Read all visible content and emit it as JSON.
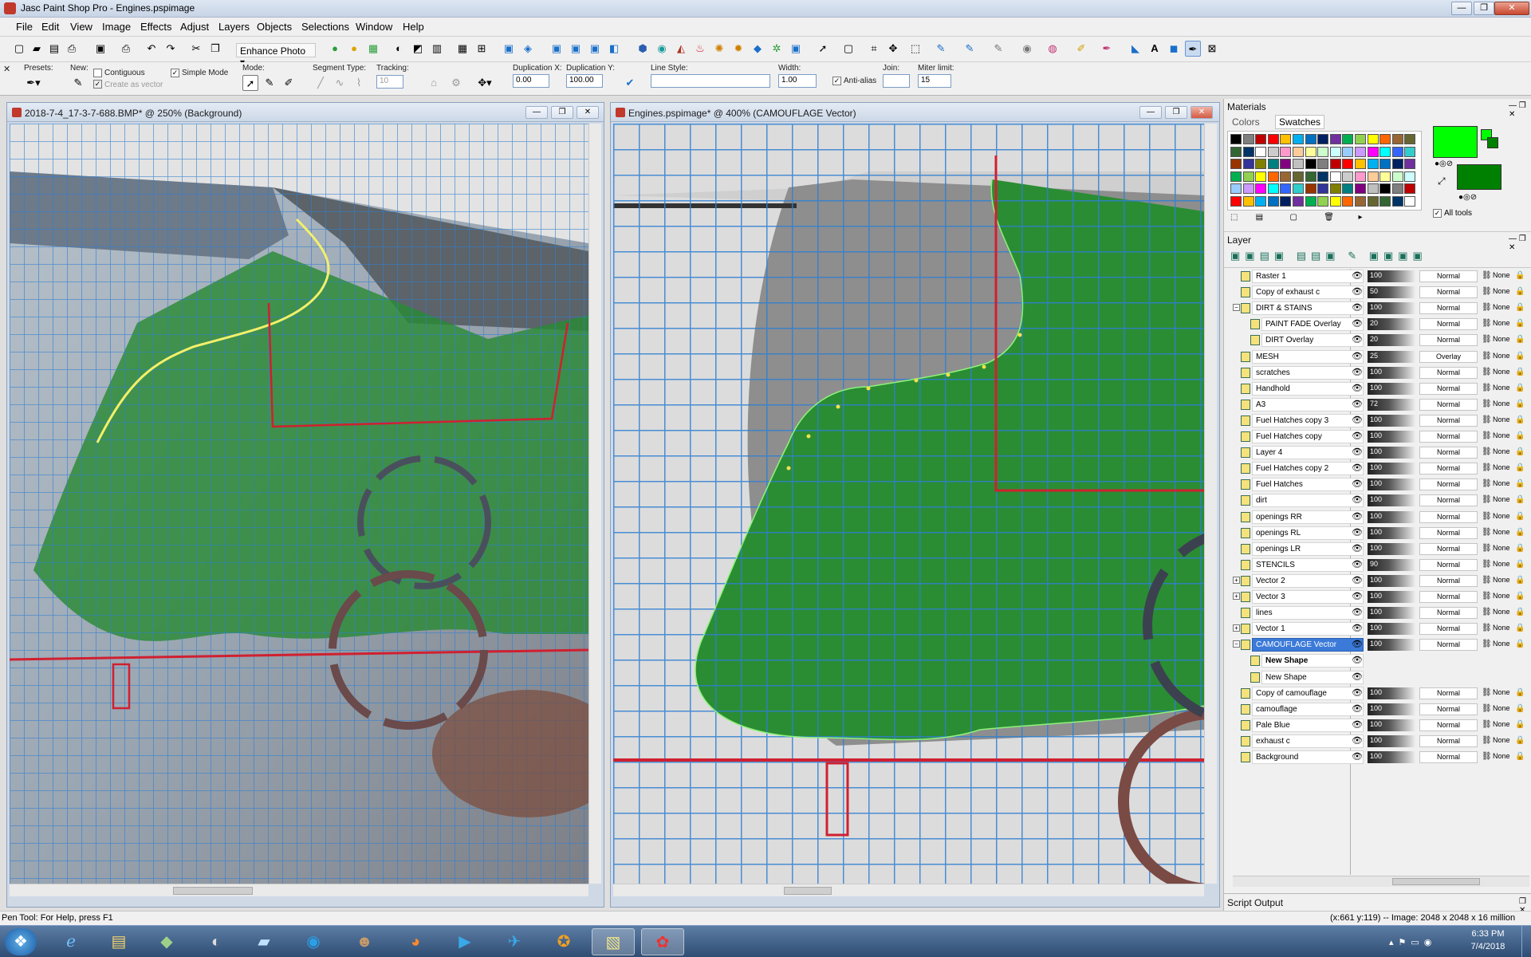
{
  "app": {
    "title": "Jasc Paint Shop Pro - Engines.pspimage",
    "window_buttons": [
      "—",
      "❐",
      "✕"
    ]
  },
  "menu": [
    "File",
    "Edit",
    "View",
    "Image",
    "Effects",
    "Adjust",
    "Layers",
    "Objects",
    "Selections",
    "Window",
    "Help"
  ],
  "toolbar": {
    "enhance_photo": "Enhance Photo ▾",
    "icons": [
      "new-icon",
      "open-icon",
      "browse-icon",
      "save-icon",
      "print-icon",
      "undo-icon",
      "redo-icon",
      "cut-icon",
      "copy-icon"
    ]
  },
  "tool_options": {
    "presets_label": "Presets:",
    "new_label": "New:",
    "contiguous": "Contiguous",
    "create_as_vector": "Create as vector",
    "simple_mode": "Simple Mode",
    "mode_label": "Mode:",
    "segment_type_label": "Segment Type:",
    "tracking_label": "Tracking:",
    "tracking_value": "10",
    "duplication_x_label": "Duplication X:",
    "duplication_x_value": "0.00",
    "duplication_y_label": "Duplication Y:",
    "duplication_y_value": "100.00",
    "line_style_label": "Line Style:",
    "width_label": "Width:",
    "width_value": "1.00",
    "antialias": "Anti-alias",
    "join_label": "Join:",
    "miter_label": "Miter limit:",
    "miter_value": "15"
  },
  "doc_left": {
    "title": "2018-7-4_17-3-7-688.BMP* @ 250% (Background)"
  },
  "doc_right": {
    "title": "Engines.pspimage* @ 400% (CAMOUFLAGE Vector)"
  },
  "materials": {
    "title": "Materials",
    "tab_colors": "Colors",
    "tab_swatches": "Swatches",
    "all_tools": "All tools",
    "foreground_color": "#00ff00",
    "background_color": "#008000",
    "swatch_colors": [
      "#000000",
      "#7f7f7f",
      "#c00000",
      "#ff0000",
      "#ffc000",
      "#00b0f0",
      "#0070c0",
      "#002060",
      "#7030a0",
      "#00b050",
      "#92d050",
      "#ffff00",
      "#ff6600",
      "#996633",
      "#666633",
      "#336633",
      "#003366",
      "#ffffff",
      "#cccccc",
      "#ff99cc",
      "#ffcc99",
      "#ffff99",
      "#ccffcc",
      "#ccffff",
      "#99ccff",
      "#cc99ff",
      "#ff00ff",
      "#00ffff",
      "#3366ff",
      "#33cccc",
      "#993300",
      "#333399",
      "#808000",
      "#008080",
      "#800080",
      "#c0c0c0"
    ]
  },
  "layers_panel": {
    "title": "Layer",
    "layers": [
      {
        "name": "Raster 1",
        "opacity": "100",
        "blend": "Normal",
        "link": "None"
      },
      {
        "name": "Copy of exhaust c",
        "opacity": "50",
        "blend": "Normal",
        "link": "None"
      },
      {
        "name": "DIRT & STAINS",
        "opacity": "100",
        "blend": "Normal",
        "link": "None"
      },
      {
        "name": "PAINT FADE Overlay",
        "opacity": "20",
        "blend": "Normal",
        "link": "None"
      },
      {
        "name": "DIRT Overlay",
        "opacity": "20",
        "blend": "Normal",
        "link": "None"
      },
      {
        "name": "MESH",
        "opacity": "25",
        "blend": "Overlay",
        "link": "None"
      },
      {
        "name": "scratches",
        "opacity": "100",
        "blend": "Normal",
        "link": "None"
      },
      {
        "name": "Handhold",
        "opacity": "100",
        "blend": "Normal",
        "link": "None"
      },
      {
        "name": "A3",
        "opacity": "72",
        "blend": "Normal",
        "link": "None"
      },
      {
        "name": "Fuel Hatches copy 3",
        "opacity": "100",
        "blend": "Normal",
        "link": "None"
      },
      {
        "name": "Fuel Hatches copy",
        "opacity": "100",
        "blend": "Normal",
        "link": "None"
      },
      {
        "name": "Layer 4",
        "opacity": "100",
        "blend": "Normal",
        "link": "None"
      },
      {
        "name": "Fuel Hatches copy 2",
        "opacity": "100",
        "blend": "Normal",
        "link": "None"
      },
      {
        "name": "Fuel Hatches",
        "opacity": "100",
        "blend": "Normal",
        "link": "None"
      },
      {
        "name": "dirt",
        "opacity": "100",
        "blend": "Normal",
        "link": "None"
      },
      {
        "name": "openings RR",
        "opacity": "100",
        "blend": "Normal",
        "link": "None"
      },
      {
        "name": "openings RL",
        "opacity": "100",
        "blend": "Normal",
        "link": "None"
      },
      {
        "name": "openings LR",
        "opacity": "100",
        "blend": "Normal",
        "link": "None"
      },
      {
        "name": "STENCILS",
        "opacity": "90",
        "blend": "Normal",
        "link": "None"
      },
      {
        "name": "Vector 2",
        "opacity": "100",
        "blend": "Normal",
        "link": "None"
      },
      {
        "name": "Vector 3",
        "opacity": "100",
        "blend": "Normal",
        "link": "None"
      },
      {
        "name": "lines",
        "opacity": "100",
        "blend": "Normal",
        "link": "None"
      },
      {
        "name": "Vector 1",
        "opacity": "100",
        "blend": "Normal",
        "link": "None"
      },
      {
        "name": "CAMOUFLAGE Vector",
        "opacity": "100",
        "blend": "Normal",
        "link": "None"
      },
      {
        "name": "New Shape",
        "opacity": "",
        "blend": "",
        "link": ""
      },
      {
        "name": "New Shape",
        "opacity": "",
        "blend": "",
        "link": ""
      },
      {
        "name": "Copy of camouflage",
        "opacity": "100",
        "blend": "Normal",
        "link": "None"
      },
      {
        "name": "camouflage",
        "opacity": "100",
        "blend": "Normal",
        "link": "None"
      },
      {
        "name": "Pale Blue",
        "opacity": "100",
        "blend": "Normal",
        "link": "None"
      },
      {
        "name": "exhaust c",
        "opacity": "100",
        "blend": "Normal",
        "link": "None"
      },
      {
        "name": "Background",
        "opacity": "100",
        "blend": "Normal",
        "link": "None"
      }
    ]
  },
  "script_output": {
    "title": "Script Output"
  },
  "status": {
    "left": "Pen Tool: For Help, press F1",
    "right": "(x:661 y:119) -- Image:  2048 x 2048 x 16 million"
  },
  "taskbar": {
    "time": "6:33 PM",
    "date": "7/4/2018",
    "apps": [
      "start-icon",
      "ie-icon",
      "explorer-icon",
      "app-icon",
      "notes-icon",
      "network-icon",
      "gimp-icon",
      "firefox-icon",
      "outlook-icon",
      "plane-icon",
      "compass-icon",
      "folder-icon",
      "psp-icon"
    ]
  },
  "colors": {
    "grid_blue": "#2f7fd1",
    "camo_green": "#1e8a2e",
    "selection_red": "#d02030",
    "highlight": "#3b7ad8"
  }
}
